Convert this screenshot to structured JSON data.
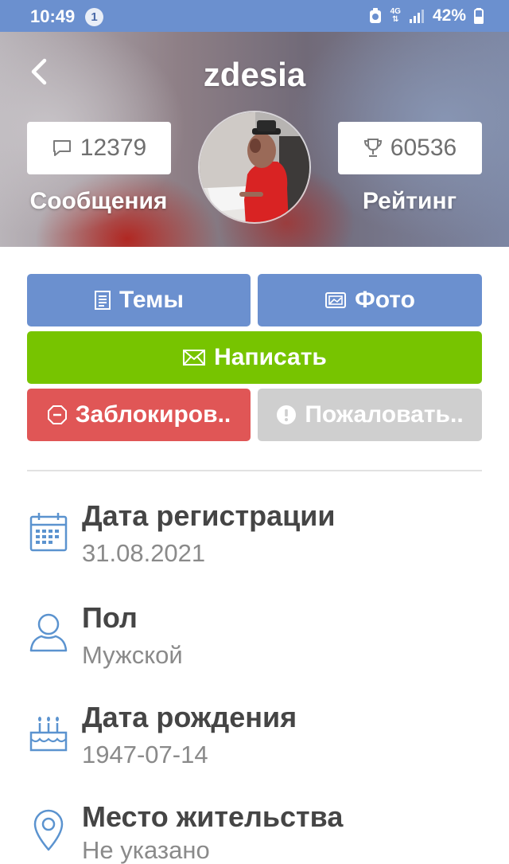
{
  "status_bar": {
    "time": "10:49",
    "notification_count": "1",
    "network": "4G",
    "battery": "42%"
  },
  "header": {
    "username": "zdesia",
    "messages": {
      "value": "12379",
      "label": "Сообщения",
      "icon": "speech-bubble-icon"
    },
    "rating": {
      "value": "60536",
      "label": "Рейтинг",
      "icon": "trophy-icon"
    }
  },
  "actions": {
    "topics": {
      "label": "Темы",
      "icon": "document-icon"
    },
    "photos": {
      "label": "Фото",
      "icon": "photo-icon"
    },
    "write": {
      "label": "Написать",
      "icon": "envelope-icon"
    },
    "block": {
      "label": "Заблокиров..",
      "icon": "stop-sign-icon"
    },
    "report": {
      "label": "Пожаловать..",
      "icon": "exclamation-icon"
    }
  },
  "profile_info": [
    {
      "title": "Дата регистрации",
      "value": "31.08.2021",
      "icon": "calendar-icon"
    },
    {
      "title": "Пол",
      "value": "Мужской",
      "icon": "person-icon"
    },
    {
      "title": "Дата рождения",
      "value": "1947-07-14",
      "icon": "birthday-cake-icon"
    },
    {
      "title": "Место жительства",
      "value": "Не указано",
      "icon": "location-pin-icon"
    }
  ],
  "colors": {
    "primary_blue": "#6b90cf",
    "green": "#77c400",
    "red": "#e05656",
    "gray": "#cfcfcf",
    "icon_blue": "#5b93cf"
  }
}
